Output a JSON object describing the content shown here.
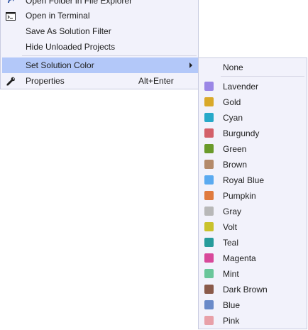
{
  "context_menu": {
    "items": [
      {
        "label": "Open Folder in File Explorer",
        "icon": "folder-arrow-icon"
      },
      {
        "label": "Open in Terminal",
        "icon": "terminal-icon"
      },
      {
        "label": "Save As Solution Filter"
      },
      {
        "label": "Hide Unloaded Projects"
      },
      {
        "label": "Set Solution Color",
        "has_submenu": true,
        "highlighted": true
      },
      {
        "label": "Properties",
        "shortcut": "Alt+Enter",
        "icon": "wrench-icon"
      }
    ],
    "highlight_color": "#b3c8f9"
  },
  "color_submenu": {
    "none_label": "None",
    "colors": [
      {
        "label": "Lavender",
        "color": "#9b87e6"
      },
      {
        "label": "Gold",
        "color": "#d9a92a"
      },
      {
        "label": "Cyan",
        "color": "#27a9c9"
      },
      {
        "label": "Burgundy",
        "color": "#d3606a"
      },
      {
        "label": "Green",
        "color": "#6a9a2a"
      },
      {
        "label": "Brown",
        "color": "#b48a6a"
      },
      {
        "label": "Royal Blue",
        "color": "#5aaaf0"
      },
      {
        "label": "Pumpkin",
        "color": "#e07a3e"
      },
      {
        "label": "Gray",
        "color": "#b8b8b8"
      },
      {
        "label": "Volt",
        "color": "#c9c22c"
      },
      {
        "label": "Teal",
        "color": "#279b9b"
      },
      {
        "label": "Magenta",
        "color": "#d8489a"
      },
      {
        "label": "Mint",
        "color": "#6ac69a"
      },
      {
        "label": "Dark Brown",
        "color": "#8a5a4a"
      },
      {
        "label": "Blue",
        "color": "#6a8ac9"
      },
      {
        "label": "Pink",
        "color": "#e8a0a8"
      }
    ]
  }
}
